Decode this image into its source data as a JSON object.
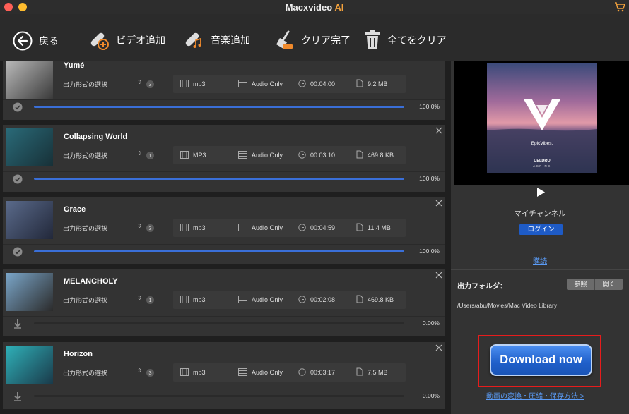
{
  "window": {
    "title_main": "Macxvideo",
    "title_ai": "AI"
  },
  "toolbar": {
    "back_label": "戻る",
    "add_video_label": "ビデオ追加",
    "add_music_label": "音楽追加",
    "clear_done_label": "クリア完了",
    "clear_all_label": "全てをクリア"
  },
  "items": [
    {
      "title": "Yumé",
      "format_label": "出力形式の選択",
      "badge": "3",
      "format": "mp3",
      "mode": "Audio Only",
      "duration": "00:04:00",
      "size": "9.2 MB",
      "progress_text": "100.0%",
      "progress": 1.0,
      "status": "done"
    },
    {
      "title": "Collapsing World",
      "format_label": "出力形式の選択",
      "badge": "1",
      "format": "MP3",
      "mode": "Audio Only",
      "duration": "00:03:10",
      "size": "469.8 KB",
      "progress_text": "100.0%",
      "progress": 1.0,
      "status": "done"
    },
    {
      "title": "Grace",
      "format_label": "出力形式の選択",
      "badge": "3",
      "format": "mp3",
      "mode": "Audio Only",
      "duration": "00:04:59",
      "size": "11.4 MB",
      "progress_text": "100.0%",
      "progress": 1.0,
      "status": "done"
    },
    {
      "title": "MELANCHOLY",
      "format_label": "出力形式の選択",
      "badge": "1",
      "format": "mp3",
      "mode": "Audio Only",
      "duration": "00:02:08",
      "size": "469.8 KB",
      "progress_text": "0.00%",
      "progress": 0.0,
      "status": "pending"
    },
    {
      "title": "Horizon",
      "format_label": "出力形式の選択",
      "badge": "3",
      "format": "mp3",
      "mode": "Audio Only",
      "duration": "00:03:17",
      "size": "7.5 MB",
      "progress_text": "0.00%",
      "progress": 0.0,
      "status": "pending"
    }
  ],
  "right_panel": {
    "cover_brand": "EpicVibes.",
    "cover_artist": "CELDRO",
    "cover_title": "ASPIRE",
    "channel": "マイチャンネル",
    "login_label": "ログイン",
    "subscribe_label": "購読",
    "output_folder_label": "出力フォルダ：",
    "browse_label": "参照",
    "open_label": "開く",
    "output_path": "/Users/abu/Movies/Mac Video Library",
    "download_label": "Download now",
    "howto_link": "動画の変換・圧縮・保存方法 >"
  },
  "colors": {
    "accent": "#3a6fd8",
    "download_frame": "#e61c1c",
    "link": "#5b9cf7",
    "ai_orange": "#f4a23c"
  }
}
